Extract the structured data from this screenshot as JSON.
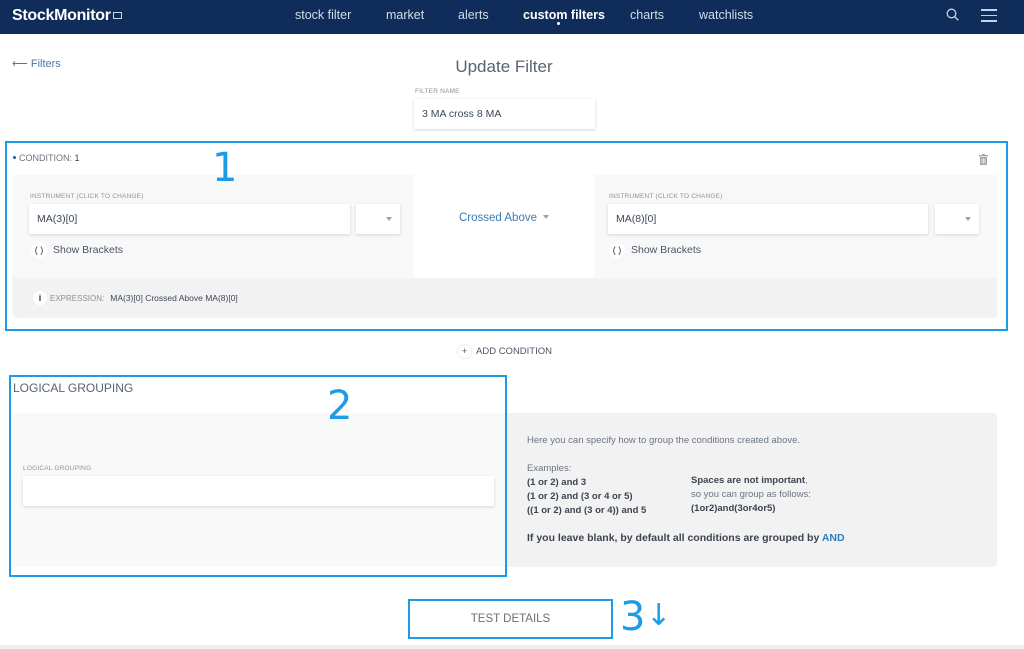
{
  "app": {
    "logo": "StockMonitor"
  },
  "nav": {
    "items": [
      {
        "label": "stock filter"
      },
      {
        "label": "market"
      },
      {
        "label": "alerts"
      },
      {
        "label": "custom filters",
        "active": true
      },
      {
        "label": "charts"
      },
      {
        "label": "watchlists"
      }
    ],
    "search_icon": "search-icon",
    "menu_icon": "hamburger-menu-icon"
  },
  "back_link": {
    "arrow": "⟵",
    "label": "Filters"
  },
  "page_title": "Update Filter",
  "filter_name": {
    "label": "FILTER NAME",
    "value": "3 MA cross 8 MA"
  },
  "condition": {
    "label": "CONDITION:",
    "number": "1",
    "left": {
      "label": "INSTRUMENT (CLICK TO CHANGE)",
      "value": "MA(3)[0]",
      "brackets": "Show Brackets",
      "brackets_glyph": "( )"
    },
    "operator": "Crossed Above",
    "right": {
      "label": "INSTRUMENT (CLICK TO CHANGE)",
      "value": "MA(8)[0]",
      "brackets": "Show Brackets",
      "brackets_glyph": "( )"
    },
    "expression_label": "EXPRESSION:",
    "expression_value": "MA(3)[0] Crossed Above MA(8)[0]",
    "info_glyph": "i"
  },
  "add_condition": {
    "glyph": "+",
    "label": "ADD CONDITION"
  },
  "logical_grouping": {
    "title": "LOGICAL GROUPING",
    "field_label": "LOGICAL GROUPING",
    "value": "",
    "help": {
      "intro": "Here you can specify how to group the conditions created above.",
      "examples_label": "Examples:",
      "examples": [
        "(1 or 2) and 3",
        "(1 or 2) and (3 or 4 or 5)",
        "((1 or 2) and (3 or 4)) and 5"
      ],
      "spaces_title": "Spaces are not important",
      "spaces_line": "so you can group as follows:",
      "spaces_example": "(1or2)and(3or4or5)",
      "default_note": "If you leave blank, by default all conditions are grouped by",
      "default_operator": "AND"
    }
  },
  "test_details": {
    "label": "TEST DETAILS"
  },
  "annotations": {
    "one": "1",
    "two": "2",
    "three": "3",
    "three_arrow": "↓",
    "color": "#1c9ce6"
  },
  "colors": {
    "topbar": "#0f2c5a",
    "accent": "#2a7fc0"
  }
}
